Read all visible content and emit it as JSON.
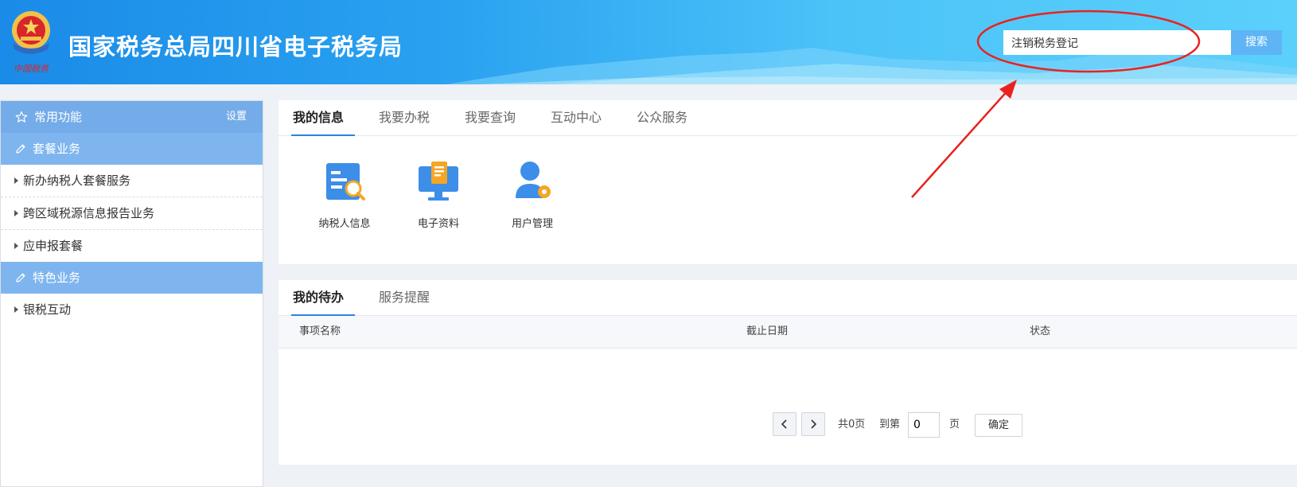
{
  "header": {
    "title": "国家税务总局四川省电子税务局",
    "emblem_icon": "tax-emblem-icon",
    "search": {
      "value": "注销税务登记",
      "button_label": "搜索"
    }
  },
  "sidebar": {
    "sections": [
      {
        "title": "常用功能",
        "icon": "star-icon",
        "action_label": "设置",
        "items": []
      },
      {
        "title": "套餐业务",
        "icon": "pencil-icon",
        "items": [
          "新办纳税人套餐服务",
          "跨区域税源信息报告业务",
          "应申报套餐"
        ]
      },
      {
        "title": "特色业务",
        "icon": "pencil-icon",
        "items": [
          "银税互动"
        ]
      }
    ]
  },
  "info_panel": {
    "tabs": [
      "我的信息",
      "我要办税",
      "我要查询",
      "互动中心",
      "公众服务"
    ],
    "active_tab": 0,
    "shortcuts": [
      {
        "label": "纳税人信息",
        "icon": "taxpayer-info-icon"
      },
      {
        "label": "电子资料",
        "icon": "electronic-documents-icon"
      },
      {
        "label": "用户管理",
        "icon": "user-management-icon"
      }
    ]
  },
  "todo_panel": {
    "tabs": [
      "我的待办",
      "服务提醒"
    ],
    "active_tab": 0,
    "columns": [
      "事项名称",
      "截止日期",
      "状态"
    ],
    "rows": [],
    "pager": {
      "total_text": "共0页",
      "goto_label": "到第",
      "page_value": "0",
      "page_unit": "页",
      "confirm_label": "确定"
    }
  },
  "colors": {
    "header_gradient_start": "#1a8be8",
    "header_gradient_end": "#5bd0fb",
    "sidebar_header": "#7fb5ef",
    "active_tab_underline": "#2a84e0",
    "search_button": "#5fb4f5",
    "annotation_red": "#e8231f"
  }
}
